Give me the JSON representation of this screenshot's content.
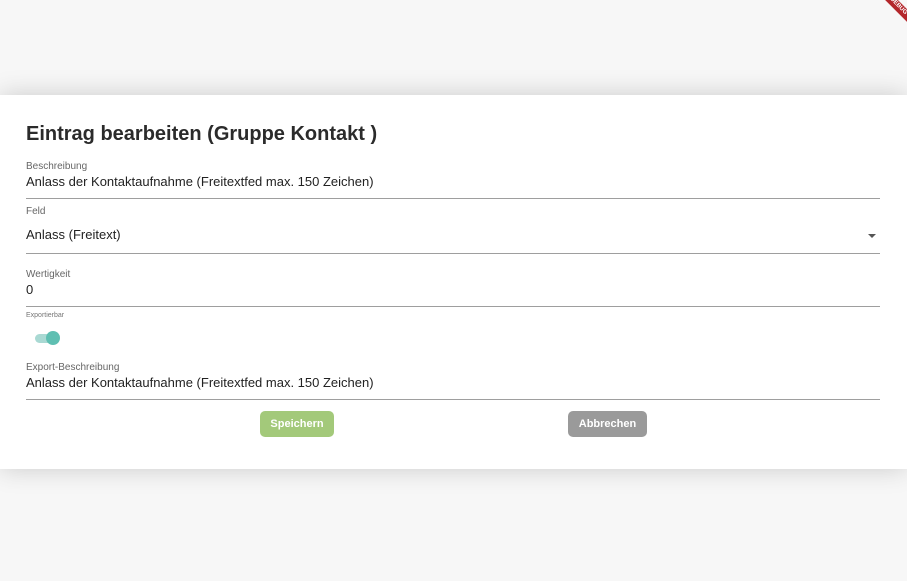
{
  "debug_banner": "DEBUG",
  "dialog": {
    "title": "Eintrag bearbeiten (Gruppe Kontakt )",
    "fields": {
      "beschreibung": {
        "label": "Beschreibung",
        "value": "Anlass der Kontaktaufnahme (Freitextfed max. 150 Zeichen)"
      },
      "feld": {
        "label": "Feld",
        "value": "Anlass  (Freitext)"
      },
      "wertigkeit": {
        "label": "Wertigkeit",
        "value": "0"
      },
      "exportierbar": {
        "label": "Exportierbar",
        "checked": true
      },
      "export_beschreibung": {
        "label": "Export-Beschreibung",
        "value": "Anlass der Kontaktaufnahme (Freitextfed max. 150 Zeichen)"
      }
    },
    "buttons": {
      "save": "Speichern",
      "cancel": "Abbrechen"
    }
  },
  "colors": {
    "save_button": "#a3c97a",
    "cancel_button": "#9a9a9a",
    "toggle_track": "#a9d9d3",
    "toggle_thumb": "#5fbfb2",
    "debug_ribbon": "#b3262b"
  }
}
